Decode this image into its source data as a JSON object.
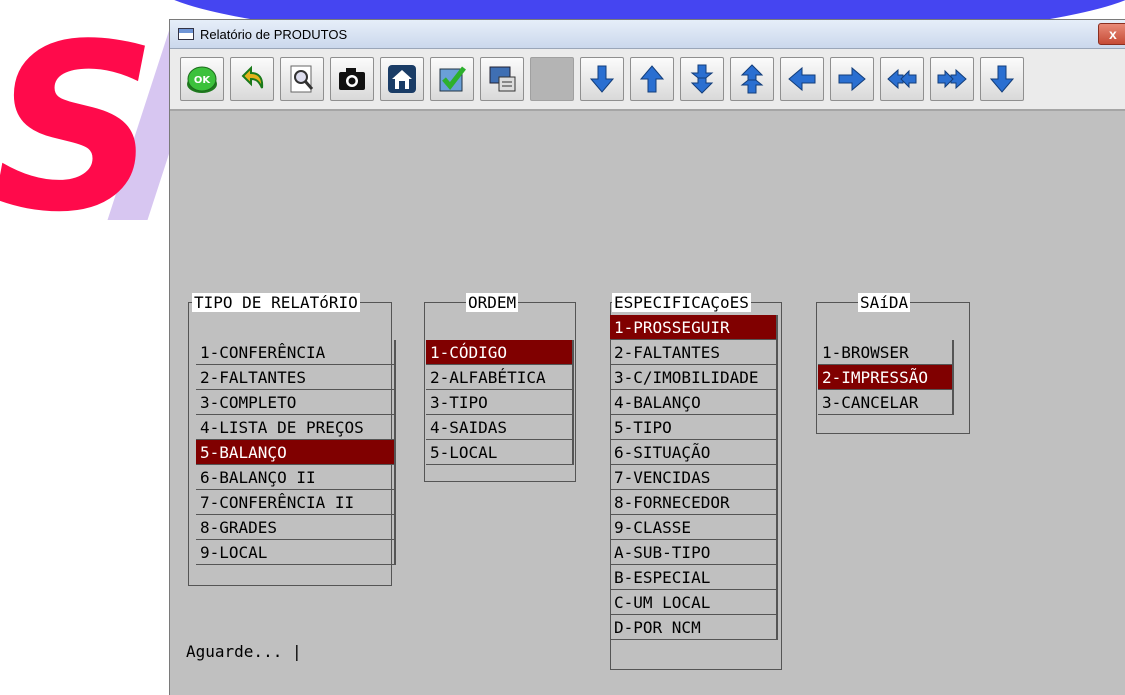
{
  "window": {
    "title": "Relatório de PRODUTOS",
    "close_label": "x"
  },
  "toolbar": {
    "buttons": [
      {
        "icon": "ok-button-icon",
        "label": "OK"
      },
      {
        "icon": "undo-arrow-icon"
      },
      {
        "icon": "preview-magnifier-icon"
      },
      {
        "icon": "camera-icon"
      },
      {
        "icon": "home-icon"
      },
      {
        "icon": "checkmark-icon"
      },
      {
        "icon": "computer-printer-icon"
      },
      {
        "icon": "blank"
      },
      {
        "icon": "arrow-down-icon"
      },
      {
        "icon": "arrow-up-icon"
      },
      {
        "icon": "double-arrow-down-icon"
      },
      {
        "icon": "double-arrow-up-icon"
      },
      {
        "icon": "arrow-left-icon"
      },
      {
        "icon": "arrow-right-icon"
      },
      {
        "icon": "double-arrow-left-icon"
      },
      {
        "icon": "double-arrow-right-icon"
      },
      {
        "icon": "arrow-down-end-icon"
      }
    ]
  },
  "menus": {
    "tipo": {
      "title": "TIPO DE RELATóRIO",
      "items": [
        "1-CONFERÊNCIA",
        "2-FALTANTES",
        "3-COMPLETO",
        "4-LISTA DE PREÇOS",
        "5-BALANÇO",
        "6-BALANÇO II",
        "7-CONFERÊNCIA II",
        "8-GRADES",
        "9-LOCAL"
      ],
      "selected_index": 4
    },
    "ordem": {
      "title": "ORDEM",
      "items": [
        "1-CÓDIGO",
        "2-ALFABÉTICA",
        "3-TIPO",
        "4-SAIDAS",
        "5-LOCAL"
      ],
      "selected_index": 0
    },
    "especificacoes": {
      "title": "ESPECIFICAÇoES",
      "items": [
        "1-PROSSEGUIR",
        "2-FALTANTES",
        "3-C/IMOBILIDADE",
        "4-BALANÇO",
        "5-TIPO",
        "6-SITUAÇÃO",
        "7-VENCIDAS",
        "8-FORNECEDOR",
        "9-CLASSE",
        "A-SUB-TIPO",
        "B-ESPECIAL",
        "C-UM LOCAL",
        "D-POR NCM"
      ],
      "selected_index": 0
    },
    "saida": {
      "title": "SAíDA",
      "items": [
        "1-BROWSER",
        "2-IMPRESSÃO",
        "3-CANCELAR"
      ],
      "selected_index": 1
    }
  },
  "status": {
    "text": "Aguarde... |"
  },
  "colors": {
    "selection": "#800000",
    "background": "#c0c0c0",
    "watermark_red": "#ff0a4b",
    "watermark_blue": "#3b3bf0"
  }
}
